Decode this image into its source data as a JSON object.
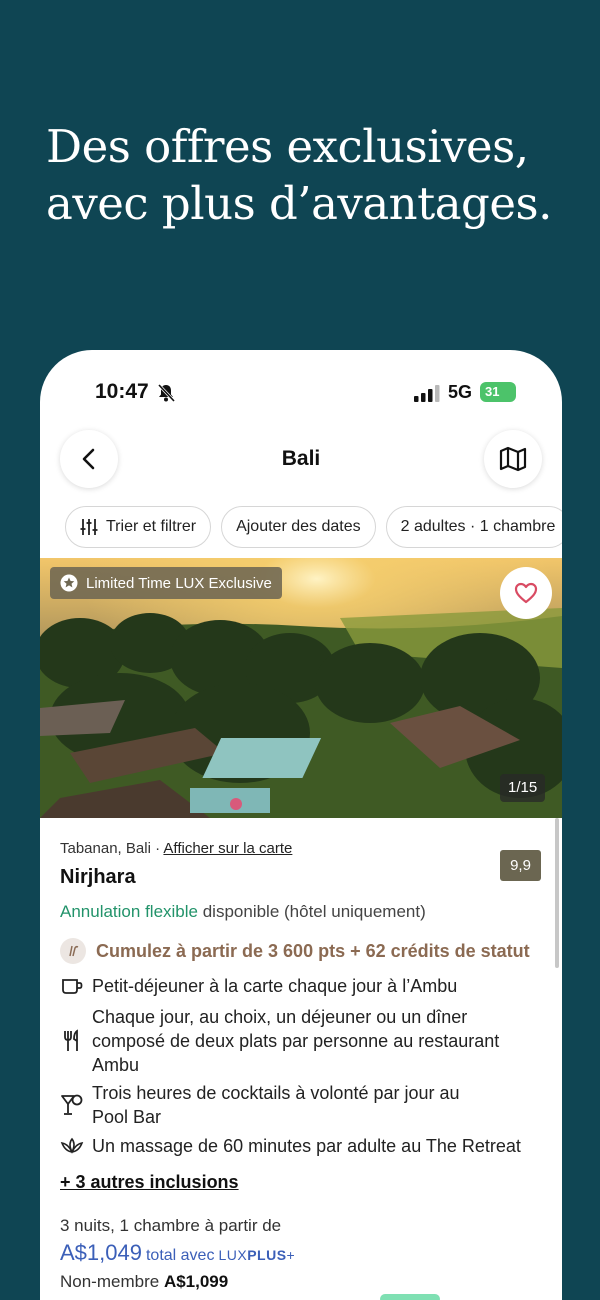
{
  "headline": {
    "line1": "Des offres exclusives,",
    "line2": "avec plus d’avantages."
  },
  "status_bar": {
    "time": "10:47",
    "network": "5G",
    "battery": "31"
  },
  "nav": {
    "title": "Bali"
  },
  "filters": {
    "sort_label": "Trier et filtrer",
    "dates_label": "Ajouter des dates",
    "guests_label": "2 adultes · 1 chambre"
  },
  "listing": {
    "badge": "Limited Time LUX Exclusive",
    "photo_counter": "1/15",
    "location": "Tabanan, Bali",
    "location_separator": "·",
    "map_link": "Afficher sur la carte",
    "rating": "9,9",
    "name": "Nirjhara",
    "flexible_label": "Annulation flexible",
    "flexible_suffix": "disponible (hôtel uniquement)",
    "points": "Cumulez à partir de 3 600 pts + 62 crédits de statut",
    "inclusions": [
      {
        "icon": "coffee-cup-icon",
        "text": "Petit-déjeuner à la carte chaque jour à l’Ambu"
      },
      {
        "icon": "fork-knife-icon",
        "text": "Chaque jour, au choix, un déjeuner ou un dîner composé de deux plats par personne au restaurant Ambu"
      },
      {
        "icon": "cocktail-glass-icon",
        "text": "Trois heures de cocktails à volonté par jour au Pool Bar"
      },
      {
        "icon": "lotus-icon",
        "text": "Un massage de 60 minutes par adulte au The Retreat"
      }
    ],
    "more_inclusions": "+ 3 autres inclusions",
    "price_intro": "3 nuits, 1 chambre à partir de",
    "price": "A$1,049",
    "price_suffix": "total avec",
    "luxplus_lux": "LUX",
    "luxplus_plus": "PLUS",
    "luxplus_mark": "+",
    "nonmember_label": "Non-membre",
    "nonmember_price": "A$1,099"
  },
  "colors": {
    "background": "#0f4553",
    "accent_green": "#22936a",
    "points_brown": "#8b6a52",
    "price_blue": "#3b5fb8"
  }
}
